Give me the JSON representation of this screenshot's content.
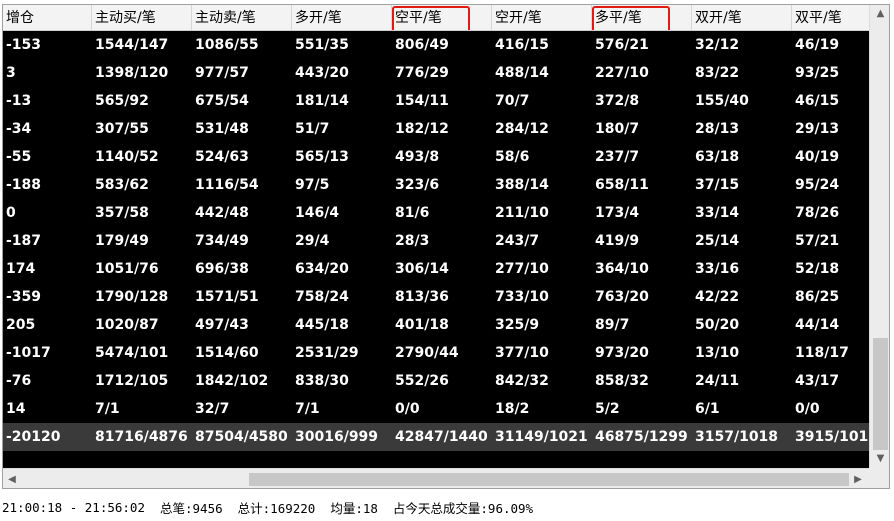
{
  "columns": [
    "增仓",
    "主动买/笔",
    "主动卖/笔",
    "多开/笔",
    "空平/笔",
    "空开/笔",
    "多平/笔",
    "双开/笔",
    "双平/笔"
  ],
  "rows": [
    [
      "-153",
      "1544/147",
      "1086/55",
      "551/35",
      "806/49",
      "416/15",
      "576/21",
      "32/12",
      "46/19"
    ],
    [
      "3",
      "1398/120",
      "977/57",
      "443/20",
      "776/29",
      "488/14",
      "227/10",
      "83/22",
      "93/25"
    ],
    [
      "-13",
      "565/92",
      "675/54",
      "181/14",
      "154/11",
      "70/7",
      "372/8",
      "155/40",
      "46/15"
    ],
    [
      "-34",
      "307/55",
      "531/48",
      "51/7",
      "182/12",
      "284/12",
      "180/7",
      "28/13",
      "29/13"
    ],
    [
      "-55",
      "1140/52",
      "524/63",
      "565/13",
      "493/8",
      "58/6",
      "237/7",
      "63/18",
      "40/19"
    ],
    [
      "-188",
      "583/62",
      "1116/54",
      "97/5",
      "323/6",
      "388/14",
      "658/11",
      "37/15",
      "95/24"
    ],
    [
      "0",
      "357/58",
      "442/48",
      "146/4",
      "81/6",
      "211/10",
      "173/4",
      "33/14",
      "78/26"
    ],
    [
      "-187",
      "179/49",
      "734/49",
      "29/4",
      "28/3",
      "243/7",
      "419/9",
      "25/14",
      "57/21"
    ],
    [
      "174",
      "1051/76",
      "696/38",
      "634/20",
      "306/14",
      "277/10",
      "364/10",
      "33/16",
      "52/18"
    ],
    [
      "-359",
      "1790/128",
      "1571/51",
      "758/24",
      "813/36",
      "733/10",
      "763/20",
      "42/22",
      "86/25"
    ],
    [
      "205",
      "1020/87",
      "497/43",
      "445/18",
      "401/18",
      "325/9",
      "89/7",
      "50/20",
      "44/14"
    ],
    [
      "-1017",
      "5474/101",
      "1514/60",
      "2531/29",
      "2790/44",
      "377/10",
      "973/20",
      "13/10",
      "118/17"
    ],
    [
      "-76",
      "1712/105",
      "1842/102",
      "838/30",
      "552/26",
      "842/32",
      "858/32",
      "24/11",
      "43/17"
    ],
    [
      "14",
      "7/1",
      "32/7",
      "7/1",
      "0/0",
      "18/2",
      "5/2",
      "6/1",
      "0/0"
    ]
  ],
  "total_row": [
    "-20120",
    "81716/4876",
    "87504/4580",
    "30016/999",
    "42847/1440",
    "31149/1021",
    "46875/1299",
    "3157/1018",
    "3915/101"
  ],
  "status": {
    "time_range": "21:00:18 - 21:56:02",
    "total_trades": "总笔:9456",
    "total_count": "总计:169220",
    "avg_volume": "均量:18",
    "share_of_day": "占今天总成交量:96.09%"
  },
  "scroll_icons": {
    "up": "chevron-up-icon",
    "down": "chevron-down-icon",
    "left": "chevron-left-icon",
    "right": "chevron-right-icon"
  },
  "colors": {
    "grid_bg": "#000000",
    "text": "#ffffff",
    "total_row_bg": "#3a3a3a",
    "highlight_box": "#e11a14"
  },
  "highlighted_columns": [
    "空平/笔",
    "多平/笔"
  ]
}
